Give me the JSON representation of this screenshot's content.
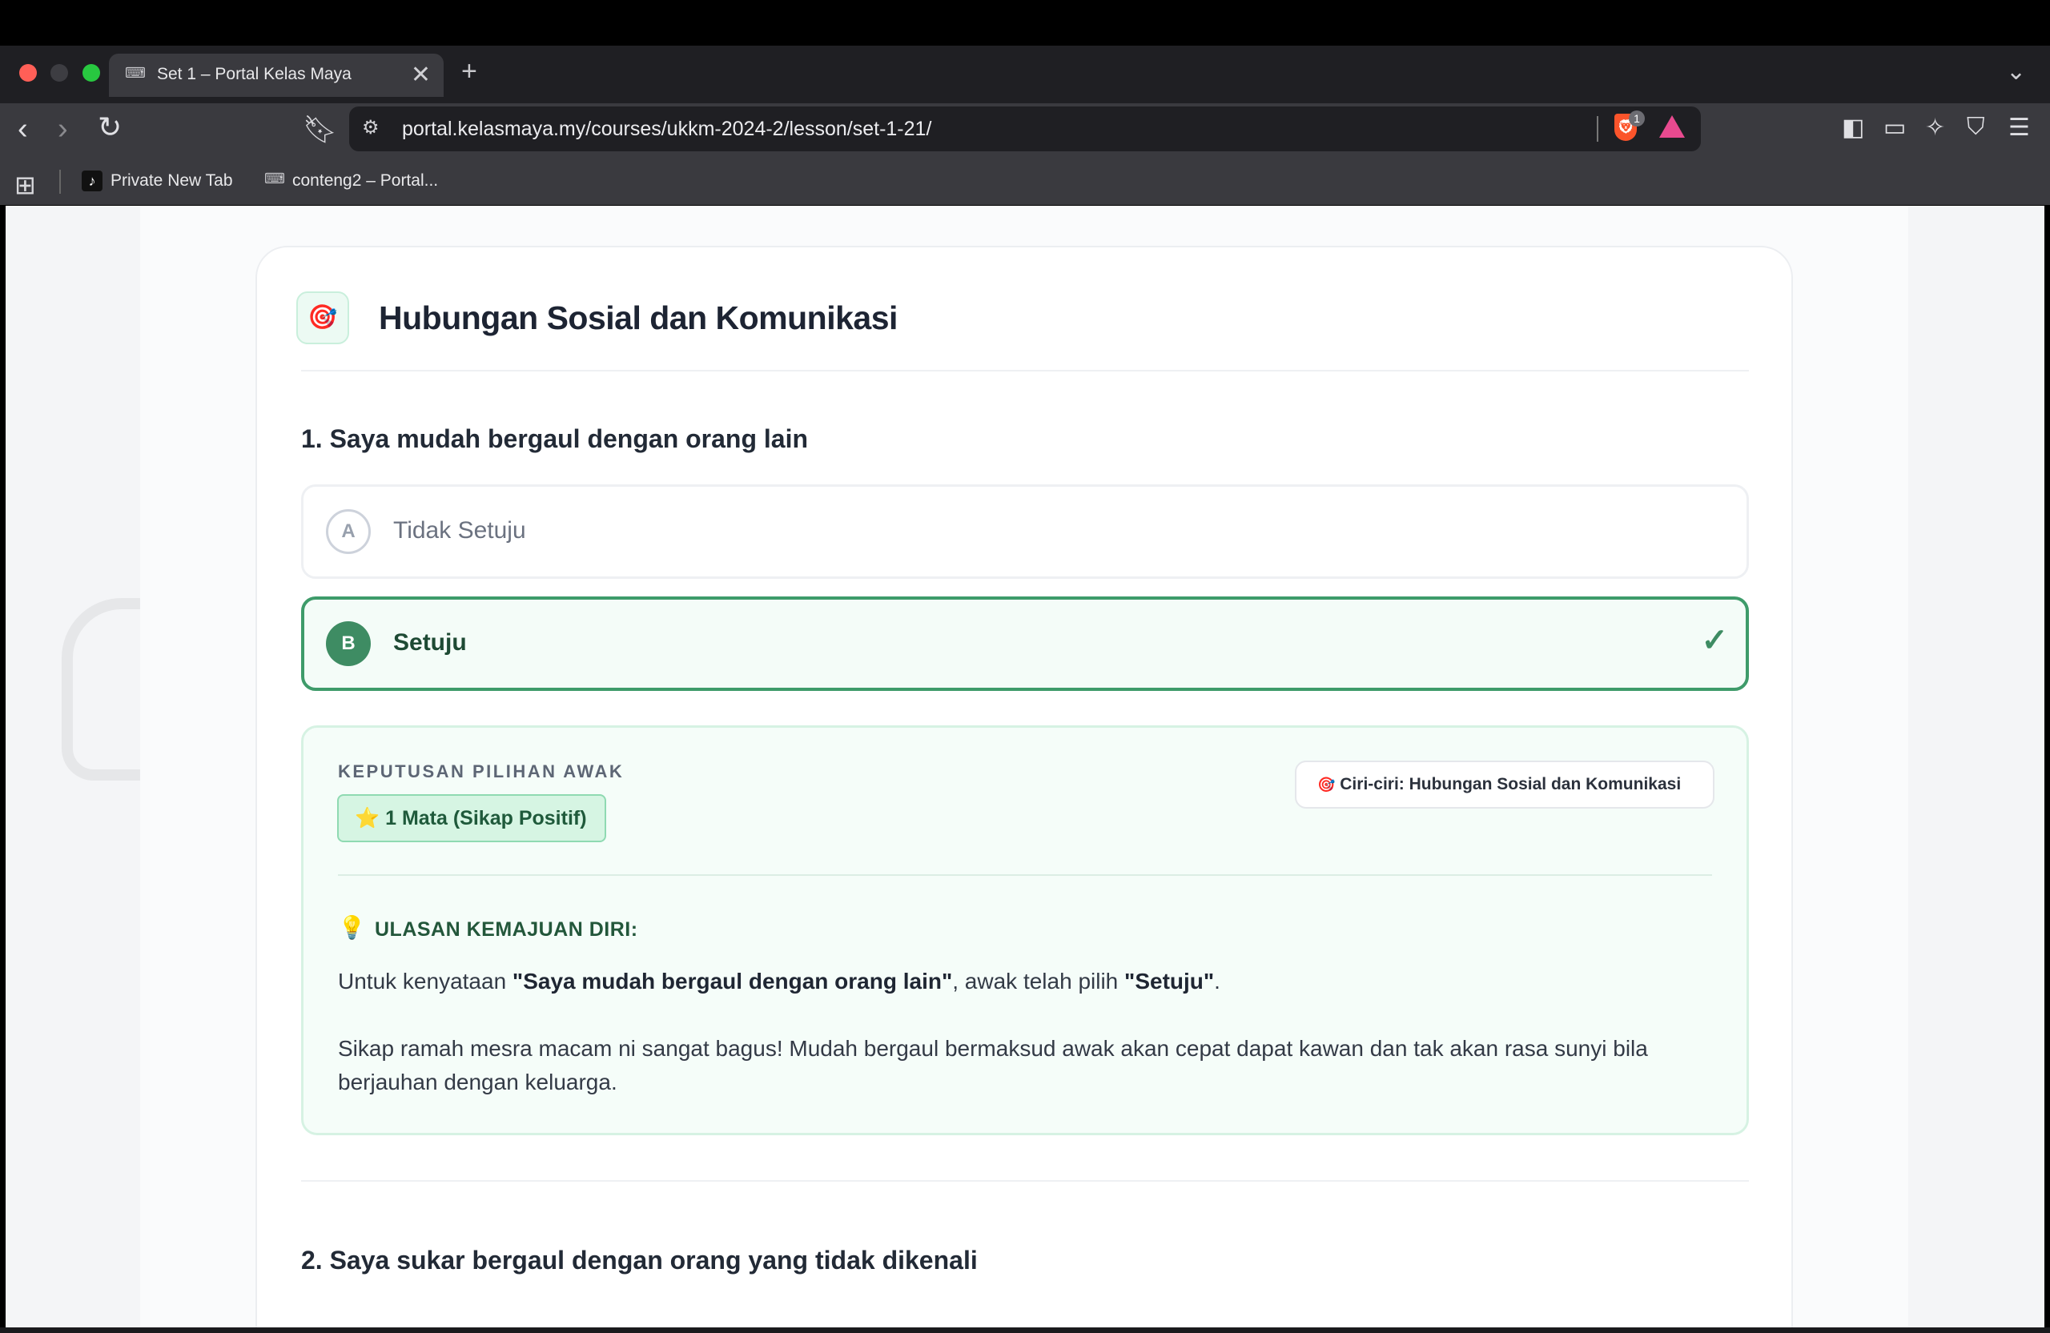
{
  "browser": {
    "tab_title": "Set 1 – Portal Kelas Maya",
    "tab_close": "✕",
    "new_tab": "+",
    "url": "portal.kelasmaya.my/courses/ukkm-2024-2/lesson/set-1-21/",
    "shield_count": "1",
    "bookmarks": [
      {
        "label": "Private New Tab",
        "icon": "tiktok-icon"
      },
      {
        "label": "conteng2 – Portal...",
        "icon": "site-favicon-icon"
      }
    ]
  },
  "section": {
    "icon": "🎯",
    "title": "Hubungan Sosial dan Komunikasi"
  },
  "questions": [
    {
      "text": "1. Saya mudah bergaul dengan orang lain",
      "options": [
        {
          "letter": "A",
          "label": "Tidak Setuju",
          "selected": false
        },
        {
          "letter": "B",
          "label": "Setuju",
          "selected": true
        }
      ],
      "selected_check": "✓",
      "feedback": {
        "kicker": "KEPUTUSAN PILIHAN AWAK",
        "score_icon": "⭐",
        "score": "1 Mata (Sikap Positif)",
        "trait_icon": "🎯",
        "trait": "Ciri-ciri: Hubungan Sosial dan Komunikasi",
        "review_icon": "💡",
        "review_title": "ULASAN KEMAJUAN DIRI:",
        "p1_prefix": "Untuk kenyataan ",
        "p1_statement": "\"Saya mudah bergaul dengan orang lain\"",
        "p1_middle": ", awak telah pilih ",
        "p1_choice": "\"Setuju\"",
        "p1_suffix": ".",
        "p2": "Sikap ramah mesra macam ni sangat bagus! Mudah bergaul bermaksud awak akan cepat dapat kawan dan tak akan rasa sunyi bila berjauhan dengan keluarga."
      }
    },
    {
      "text": "2. Saya sukar bergaul dengan orang yang tidak dikenali"
    }
  ],
  "colors": {
    "accent_green": "#3e8c63",
    "selected_border": "#3e9b6a",
    "feedback_bg": "#f5fdf9"
  }
}
